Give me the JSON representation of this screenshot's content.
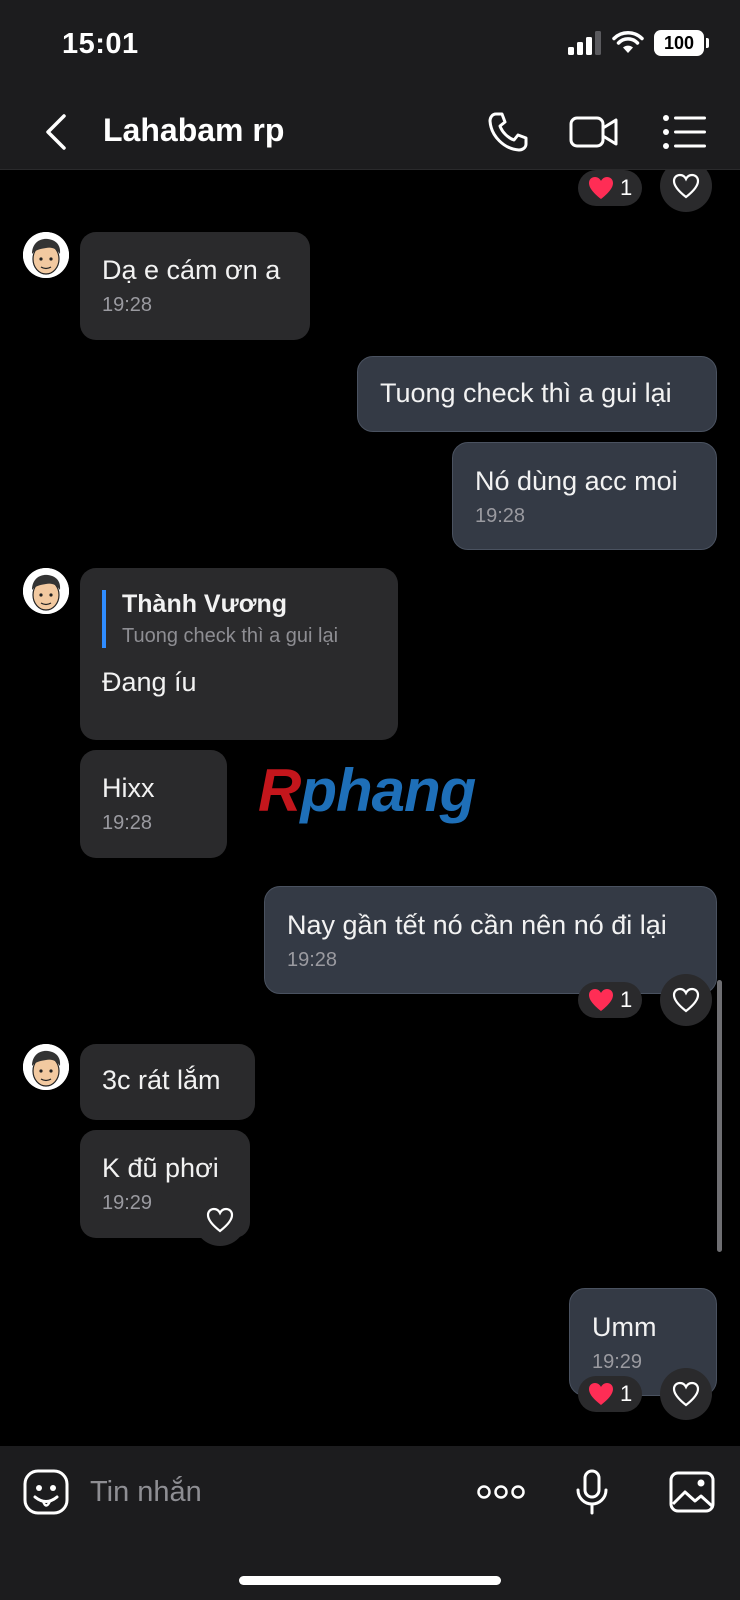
{
  "status_bar": {
    "time": "15:01",
    "battery": "100"
  },
  "header": {
    "title": "Lahabam rp"
  },
  "messages": [
    {
      "text": "Dạ e cám ơn a",
      "time": "19:28"
    },
    {
      "text": "Tuong check thì a gui lại"
    },
    {
      "text": "Nó dùng acc moi",
      "time": "19:28"
    },
    {
      "reply_name": "Thành Vương",
      "reply_text": "Tuong check thì a gui lại",
      "text": "Đang íu"
    },
    {
      "text": "Hixx",
      "time": "19:28"
    },
    {
      "text": "Nay gần tết nó cần nên nó đi lại",
      "time": "19:28"
    },
    {
      "text": "3c rát lắm"
    },
    {
      "text": "K đũ phơi",
      "time": "19:29"
    },
    {
      "text": "Umm",
      "time": "19:29"
    }
  ],
  "reactions": {
    "count": "1"
  },
  "watermark": {
    "r": "R",
    "rest": "phang"
  },
  "input": {
    "placeholder": "Tin nhắn"
  },
  "colors": {
    "accent": "#2f8cff",
    "heart": "#ff2d55",
    "outgoing_bubble": "#343a45",
    "incoming_bubble": "#2a2a2c"
  }
}
